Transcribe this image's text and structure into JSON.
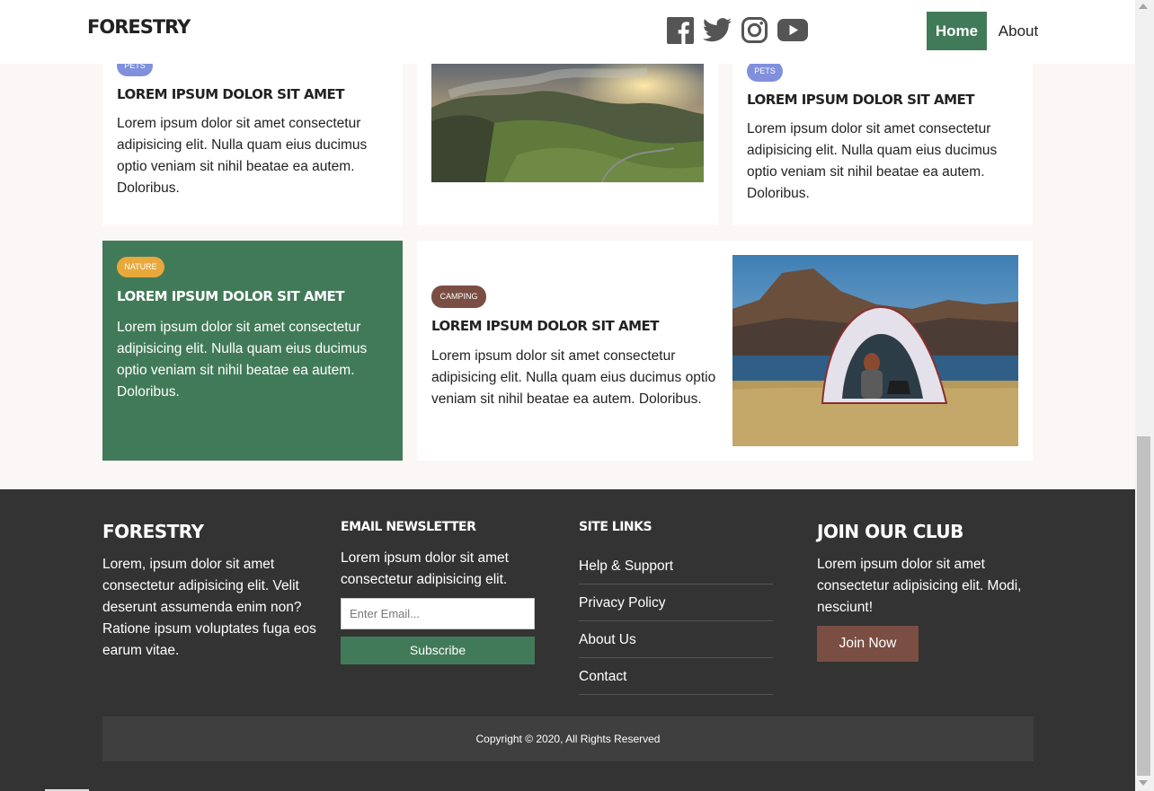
{
  "nav": {
    "brand": "FORESTRY",
    "links": [
      {
        "label": "Home",
        "active": true
      },
      {
        "label": "About",
        "active": false
      }
    ],
    "social_icons": [
      "facebook-icon",
      "twitter-icon",
      "instagram-icon",
      "youtube-icon"
    ],
    "social_color": "#555555"
  },
  "cards": [
    {
      "badge": "PETS",
      "badge_color": "#8090dd",
      "title": "LOREM IPSUM DOLOR SIT AMET",
      "text": "Lorem ipsum dolor sit amet consectetur adipisicing elit. Nulla quam eius ducimus optio veniam sit nihil beatae ea autem. Doloribus."
    },
    {
      "image": "mountain-landscape-image"
    },
    {
      "badge": "PETS",
      "badge_color": "#8090dd",
      "title": "LOREM IPSUM DOLOR SIT AMET",
      "text": "Lorem ipsum dolor sit amet consectetur adipisicing elit. Nulla quam eius ducimus optio veniam sit nihil beatae ea autem. Doloribus."
    },
    {
      "badge": "NATURE",
      "badge_color": "#e8a83c",
      "background": "#417a58",
      "title": "LOREM IPSUM DOLOR SIT AMET",
      "text": "Lorem ipsum dolor sit amet consectetur adipisicing elit. Nulla quam eius ducimus optio veniam sit nihil beatae ea autem. Doloribus."
    },
    {
      "badge": "CAMPING",
      "badge_color": "#7a4e42",
      "title": "LOREM IPSUM DOLOR SIT AMET",
      "text": "Lorem ipsum dolor sit amet consectetur adipisicing elit. Nulla quam eius ducimus optio veniam sit nihil beatae ea autem. Doloribus.",
      "image": "camping-tent-image"
    }
  ],
  "footer": {
    "about": {
      "title": "FORESTRY",
      "text": "Lorem, ipsum dolor sit amet consectetur adipisicing elit. Velit deserunt assumenda enim non? Ratione ipsum voluptates fuga eos earum vitae."
    },
    "newsletter": {
      "title": "EMAIL NEWSLETTER",
      "text": "Lorem ipsum dolor sit amet consectetur adipisicing elit.",
      "email_placeholder": "Enter Email...",
      "email_value": "",
      "button": "Subscribe"
    },
    "site_links": {
      "title": "SITE LINKS",
      "links": [
        "Help & Support",
        "Privacy Policy",
        "About Us",
        "Contact"
      ]
    },
    "club": {
      "title": "JOIN OUR CLUB",
      "text": "Lorem ipsum dolor sit amet consectetur adipisicing elit. Modi, nesciunt!",
      "button": "Join Now"
    },
    "copyright": "Copyright © 2020, All Rights Reserved"
  },
  "colors": {
    "primary_green": "#417a58",
    "brown": "#7a4e42",
    "footer_bg": "#333333",
    "page_bg": "#fbf7f7"
  }
}
